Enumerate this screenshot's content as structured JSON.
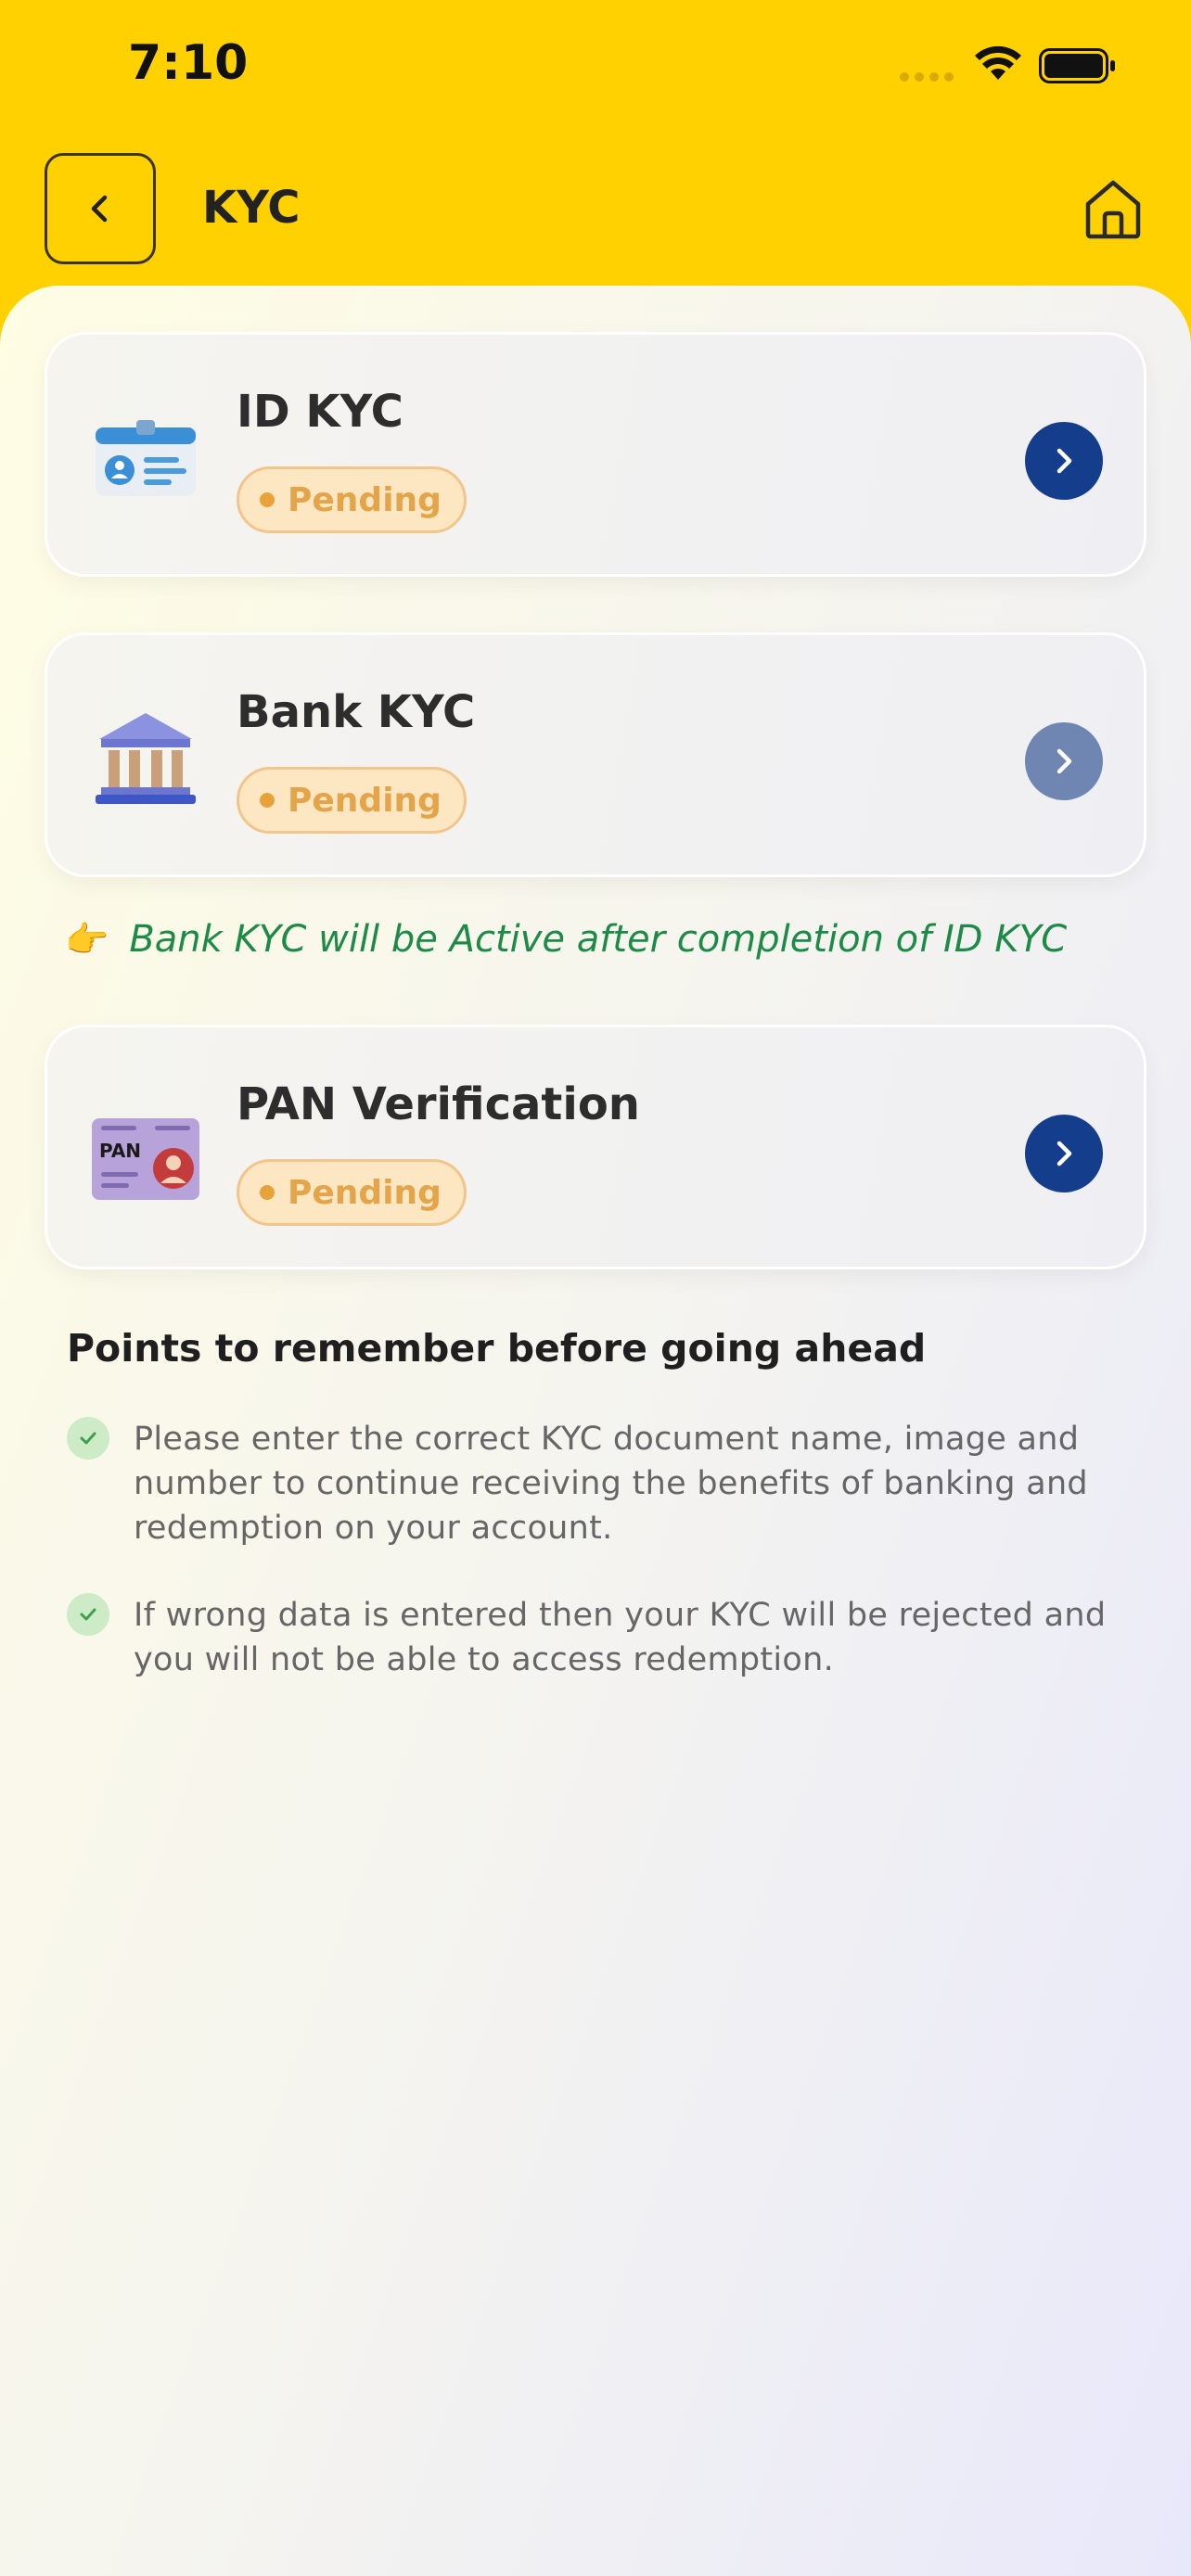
{
  "status_bar": {
    "time": "7:10"
  },
  "header": {
    "title": "KYC"
  },
  "cards": [
    {
      "title": "ID KYC",
      "status": "Pending",
      "icon": "id-card-icon",
      "arrow_enabled": true
    },
    {
      "title": "Bank KYC",
      "status": "Pending",
      "icon": "bank-icon",
      "arrow_enabled": false
    },
    {
      "title": "PAN Verification",
      "status": "Pending",
      "icon": "pan-card-icon",
      "arrow_enabled": true
    }
  ],
  "hint": {
    "icon": "pointing-hand-icon",
    "text": "Bank KYC will be Active after completion of ID KYC"
  },
  "points": {
    "title": "Points to remember before going ahead",
    "items": [
      "Please enter the correct KYC document name, image and number to continue receiving the benefits of banking and redemption on your account.",
      "If wrong data is entered then your KYC will be rejected and you will not be able to access redemption."
    ]
  },
  "colors": {
    "header_bg": "#FFD100",
    "arrow_active": "#143E8C",
    "arrow_disabled": "#6F86B3",
    "pending": "#E3A44A",
    "hint_green": "#1E8A48"
  }
}
